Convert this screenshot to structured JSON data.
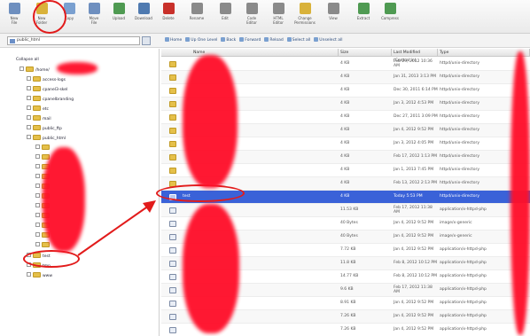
{
  "toolbar": {
    "items": [
      {
        "label": "New\nFile",
        "icon": "new-file-icon",
        "color": "#6e8fbf"
      },
      {
        "label": "New\nFolder",
        "icon": "new-folder-icon",
        "color": "#d9b23a"
      },
      {
        "label": "Copy",
        "icon": "copy-icon",
        "color": "#7aa0d0"
      },
      {
        "label": "Move\nFile",
        "icon": "move-file-icon",
        "color": "#6e8fbf"
      },
      {
        "label": "Upload",
        "icon": "upload-icon",
        "color": "#4f9a52"
      },
      {
        "label": "Download",
        "icon": "download-icon",
        "color": "#4f7ab0"
      },
      {
        "label": "Delete",
        "icon": "delete-icon",
        "color": "#c8302a"
      },
      {
        "label": "Rename",
        "icon": "rename-icon",
        "color": "#8a8a8a"
      },
      {
        "label": "Edit",
        "icon": "edit-icon",
        "color": "#8a8a8a"
      },
      {
        "label": "Code\nEditor",
        "icon": "code-editor-icon",
        "color": "#8a8a8a"
      },
      {
        "label": "HTML\nEditor",
        "icon": "html-editor-icon",
        "color": "#8a8a8a"
      },
      {
        "label": "Change\nPermissions",
        "icon": "permissions-icon",
        "color": "#d9b23a"
      },
      {
        "label": "View",
        "icon": "view-icon",
        "color": "#8a8a8a"
      },
      {
        "label": "Extract",
        "icon": "extract-icon",
        "color": "#4f9a52"
      },
      {
        "label": "Compress",
        "icon": "compress-icon",
        "color": "#4f9a52"
      }
    ]
  },
  "path_bar": {
    "value": "public_html",
    "go_label": "Go"
  },
  "actions": [
    {
      "label": "Home",
      "icon": "home-icon"
    },
    {
      "label": "Up One Level",
      "icon": "up-level-icon"
    },
    {
      "label": "Back",
      "icon": "back-icon"
    },
    {
      "label": "Forward",
      "icon": "forward-icon"
    },
    {
      "label": "Reload",
      "icon": "reload-icon"
    },
    {
      "label": "Select all",
      "icon": "select-all-icon"
    },
    {
      "label": "Unselect all",
      "icon": "unselect-all-icon"
    }
  ],
  "tree": {
    "collapse_label": "Collapse all",
    "nodes": [
      {
        "label": "/home/"
      },
      {
        "label": "access-logs"
      },
      {
        "label": "cpanel3-skel"
      },
      {
        "label": "cpanelbranding"
      },
      {
        "label": "etc"
      },
      {
        "label": "mail"
      },
      {
        "label": "public_ftp"
      },
      {
        "label": "public_html"
      },
      {
        "label": "test"
      },
      {
        "label": "tmp"
      },
      {
        "label": "www"
      }
    ]
  },
  "table": {
    "columns": [
      "Name",
      "Size",
      "Last Modified (Central in)",
      "Type"
    ],
    "rows": [
      {
        "name": "",
        "size": "4 KB",
        "modified": "Feb 29, 2012 10:36 AM",
        "type": "httpd/unix-directory",
        "icon": "folder-icon"
      },
      {
        "name": "",
        "size": "4 KB",
        "modified": "Jan 31, 2013 3:13 PM",
        "type": "httpd/unix-directory",
        "icon": "folder-icon"
      },
      {
        "name": "",
        "size": "4 KB",
        "modified": "Dec 30, 2011 6:14 PM",
        "type": "httpd/unix-directory",
        "icon": "folder-icon"
      },
      {
        "name": "",
        "size": "4 KB",
        "modified": "Jan 3, 2012 4:53 PM",
        "type": "httpd/unix-directory",
        "icon": "folder-icon"
      },
      {
        "name": "",
        "size": "4 KB",
        "modified": "Dec 27, 2011 3:09 PM",
        "type": "httpd/unix-directory",
        "icon": "folder-icon"
      },
      {
        "name": "",
        "size": "4 KB",
        "modified": "Jan 4, 2012 9:52 PM",
        "type": "httpd/unix-directory",
        "icon": "folder-icon"
      },
      {
        "name": "",
        "size": "4 KB",
        "modified": "Jan 3, 2012 4:05 PM",
        "type": "httpd/unix-directory",
        "icon": "folder-icon"
      },
      {
        "name": "",
        "size": "4 KB",
        "modified": "Feb 17, 2012 1:13 PM",
        "type": "httpd/unix-directory",
        "icon": "folder-icon"
      },
      {
        "name": "",
        "size": "4 KB",
        "modified": "Jan 1, 2013 7:45 PM",
        "type": "httpd/unix-directory",
        "icon": "folder-icon"
      },
      {
        "name": "",
        "size": "4 KB",
        "modified": "Feb 13, 2012 2:13 PM",
        "type": "httpd/unix-directory",
        "icon": "folder-icon"
      },
      {
        "name": "test",
        "size": "4 KB",
        "modified": "Today 5:53 PM",
        "type": "httpd/unix-directory",
        "icon": "folder-icon",
        "selected": true
      },
      {
        "name": "",
        "size": "11.53 KB",
        "modified": "Feb 17, 2012 11:38 AM",
        "type": "application/x-httpd-php",
        "icon": "php-file-icon"
      },
      {
        "name": "",
        "size": "40 Bytes",
        "modified": "Jan 4, 2012 9:52 PM",
        "type": "image/x-generic",
        "icon": "image-file-icon"
      },
      {
        "name": "",
        "size": "40 Bytes",
        "modified": "Jan 4, 2012 9:52 PM",
        "type": "image/x-generic",
        "icon": "image-file-icon"
      },
      {
        "name": "",
        "size": "7.72 KB",
        "modified": "Jan 4, 2012 9:52 PM",
        "type": "application/x-httpd-php",
        "icon": "php-file-icon"
      },
      {
        "name": "",
        "size": "11.8 KB",
        "modified": "Feb 8, 2012 10:12 PM",
        "type": "application/x-httpd-php",
        "icon": "php-file-icon"
      },
      {
        "name": "",
        "size": "14.77 KB",
        "modified": "Feb 8, 2012 10:12 PM",
        "type": "application/x-httpd-php",
        "icon": "php-file-icon"
      },
      {
        "name": "",
        "size": "9.6 KB",
        "modified": "Feb 17, 2012 11:38 AM",
        "type": "application/x-httpd-php",
        "icon": "php-file-icon"
      },
      {
        "name": "",
        "size": "8.91 KB",
        "modified": "Jan 4, 2012 9:52 PM",
        "type": "application/x-httpd-php",
        "icon": "php-file-icon"
      },
      {
        "name": "",
        "size": "7.26 KB",
        "modified": "Jan 4, 2012 9:52 PM",
        "type": "application/x-httpd-php",
        "icon": "php-file-icon"
      },
      {
        "name": "",
        "size": "7.26 KB",
        "modified": "Jan 4, 2012 9:52 PM",
        "type": "application/x-httpd-php",
        "icon": "php-file-icon"
      }
    ]
  },
  "colors": {
    "selection": "#3a62d8",
    "annotation": "#e21b1b",
    "redaction": "#ff0f2a"
  }
}
